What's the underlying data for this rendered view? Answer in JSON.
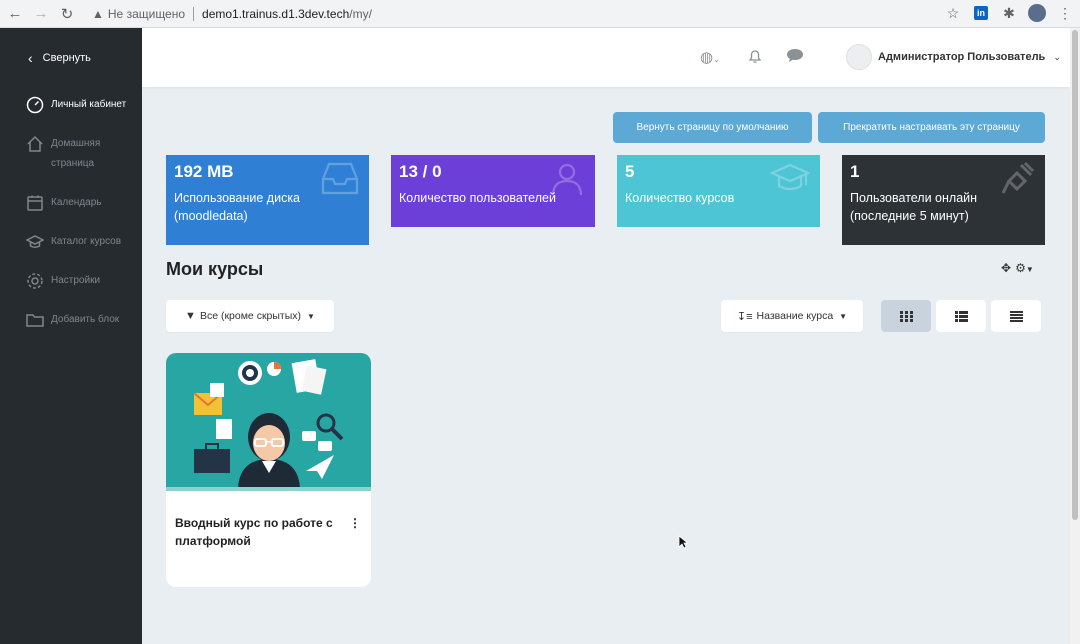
{
  "browser": {
    "security_label": "Не защищено",
    "url_domain": "demo1.trainus.d1.3dev.tech",
    "url_path": "/my/"
  },
  "sidebar": {
    "collapse_label": "Свернуть",
    "items": [
      {
        "label": "Личный кабинет",
        "icon": "dashboard-icon",
        "active": true
      },
      {
        "label": "Домашняя страница",
        "icon": "home-icon",
        "active": false
      },
      {
        "label": "Календарь",
        "icon": "calendar-icon",
        "active": false
      },
      {
        "label": "Каталог курсов",
        "icon": "catalog-icon",
        "active": false
      },
      {
        "label": "Настройки",
        "icon": "gear-icon",
        "active": false
      },
      {
        "label": "Добавить блок",
        "icon": "folder-icon",
        "active": false
      }
    ]
  },
  "header": {
    "user_name": "Администратор Пользователь"
  },
  "actions": {
    "reset_label": "Вернуть страницу по умолчанию",
    "stop_label": "Прекратить настраивать эту страницу"
  },
  "stats": [
    {
      "value": "192 MB",
      "label": "Использование диска (moodledata)",
      "color": "#2f80d4",
      "icon": "inbox-icon"
    },
    {
      "value": "13 / 0",
      "label": "Количество пользователей",
      "color": "#6c3fd8",
      "icon": "users-icon"
    },
    {
      "value": "5",
      "label": "Количество курсов",
      "color": "#4ec5d4",
      "icon": "graduation-cap-icon"
    },
    {
      "value": "1",
      "label": "Пользователи онлайн (последние 5 минут)",
      "color": "#2d3237",
      "icon": "plug-icon"
    }
  ],
  "my_courses": {
    "title": "Мои курсы",
    "filter_label": "Все (кроме скрытых)",
    "sort_label": "Название курса",
    "views": [
      "card-view",
      "list-view",
      "summary-view"
    ],
    "active_view": "card-view",
    "courses": [
      {
        "name": "Вводный курс по работе с платформой"
      }
    ]
  }
}
